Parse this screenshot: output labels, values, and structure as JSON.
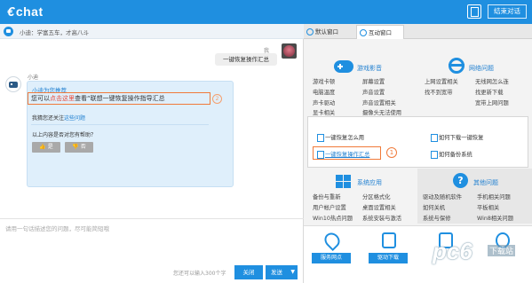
{
  "app": {
    "logo": "chat",
    "end_button": "结束对话"
  },
  "chat": {
    "subtitle": "小迪：学富五车，才高八斗",
    "me_name": "我",
    "me_message": "一键恢复操作汇总",
    "bot_name": "小迪",
    "rec_title": "小迪为您推荐",
    "rec_prefix": "您可以",
    "rec_link": "点击这里",
    "rec_suffix": "查看“联想一键恢复操作指导汇总",
    "circle_num": "2",
    "guess_prefix": "我猜您还关注",
    "guess_link": "这些问题",
    "helpful": "以上内容是否对您有帮助？",
    "vote_yes": "是",
    "vote_no": "否",
    "input_placeholder": "请用一句话描述您的问题，尽可能简短哦",
    "char_count": "您还可以输入300个字",
    "close": "关闭",
    "send": "发送"
  },
  "panel": {
    "tabs": [
      "默认窗口",
      "互动窗口"
    ],
    "games": {
      "title": "游戏影音",
      "col1": [
        "游戏卡顿",
        "电脑温度",
        "声卡驱动",
        "显卡相关"
      ],
      "col2": [
        "屏幕设置",
        "声音设置",
        "声音设置相关",
        "摄像头无法使用"
      ]
    },
    "network": {
      "title": "网络问题",
      "col1": [
        "上网设置相关",
        "找不到宽带"
      ],
      "col2": [
        "无线网怎么连",
        "找更新下载",
        "宽带上网问题"
      ]
    },
    "popover": {
      "item1": "一键恢复怎么用",
      "item2": "一键恢复操作汇总",
      "item3": "如何下载一键恢复",
      "item4": "如何备份系统",
      "circle": "1"
    },
    "system": {
      "title": "系统应用",
      "col1": [
        "备份与重新",
        "用户帐户设置",
        "Win10热点问题"
      ],
      "col2": [
        "分区格式化",
        "桌面设置相关",
        "系统安装与激活"
      ]
    },
    "other": {
      "title": "其他问题",
      "col1": [
        "驱动及随机软件",
        "如何关机",
        "系统与保修"
      ],
      "col2": [
        "手机相关问题",
        "平板相关",
        "Win8相关问题"
      ]
    },
    "tools": [
      "服务网点",
      "驱动下载",
      "",
      ""
    ]
  },
  "watermark": {
    "main": "pc6",
    "sub": "下载站"
  }
}
